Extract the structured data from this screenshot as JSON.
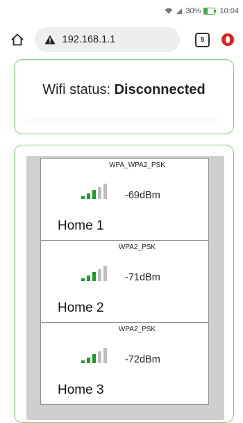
{
  "status_bar": {
    "battery": "30%",
    "time": "10:04"
  },
  "browser": {
    "url": "192.168.1.1",
    "tab_count": "5"
  },
  "wifi_status": {
    "label": "Wifi status: ",
    "value": "Disconnected"
  },
  "networks": [
    {
      "name": "Home 1",
      "security": "WPA_WPA2_PSK",
      "signal": "-69dBm",
      "strength_bars": 3,
      "max_bars": 5
    },
    {
      "name": "Home 2",
      "security": "WPA2_PSK",
      "signal": "-71dBm",
      "strength_bars": 3,
      "max_bars": 5
    },
    {
      "name": "Home 3",
      "security": "WPA2_PSK",
      "signal": "-72dBm",
      "strength_bars": 3,
      "max_bars": 5
    }
  ],
  "colors": {
    "card_border": "#7fcf7f",
    "signal_active": "#1e9b2a",
    "signal_inactive": "#bdbdbd",
    "opera_red": "#e0201b"
  }
}
